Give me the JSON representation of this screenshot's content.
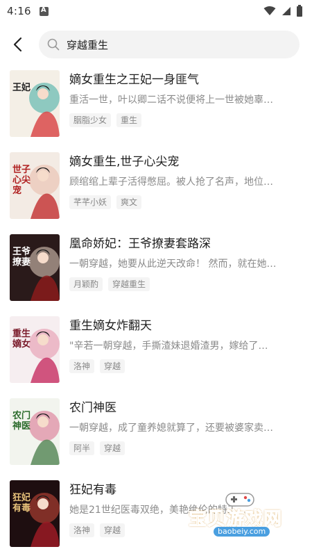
{
  "status_bar": {
    "time": "4:16"
  },
  "search": {
    "value": "穿越重生",
    "placeholder": ""
  },
  "books": [
    {
      "title": "嫡女重生之王妃一身匪气",
      "desc": "重活一世，叶以卿二话不说便将上一世被她辜…",
      "tags": [
        "胭脂少女",
        "重生"
      ],
      "cover_text": "王妃"
    },
    {
      "title": "嫡女重生,世子心尖宠",
      "desc": "顾绾绾上辈子活得憋屈。被人抢了名声，地位…",
      "tags": [
        "芊芊小妖",
        "爽文"
      ],
      "cover_text": "世子心尖宠"
    },
    {
      "title": "凰命娇妃：王爷撩妻套路深",
      "desc": "一朝穿越，她要从此逆天改命！ 然而，就在她…",
      "tags": [
        "月颖酌",
        "穿越重生"
      ],
      "cover_text": "王爷撩妻"
    },
    {
      "title": "重生嫡女炸翻天",
      "desc": "\"辛若一朝穿越，手撕渣妹退婚渣男，嫁给了…",
      "tags": [
        "洛神",
        "穿越"
      ],
      "cover_text": "重生嫡女"
    },
    {
      "title": "农门神医",
      "desc": "一朝穿越，成了童养媳就算了，还要被婆家卖…",
      "tags": [
        "阿半",
        "穿越"
      ],
      "cover_text": "农门神医"
    },
    {
      "title": "狂妃有毒",
      "desc": "她是21世纪医毒双绝，美艳绝伦的特工…",
      "tags": [
        "洛神",
        "穿越"
      ],
      "cover_text": "狂妃有毒"
    }
  ],
  "watermark": {
    "text": "宝贝游戏网",
    "url": "baobeiy.com"
  },
  "colors": {
    "accent": "#f5a623",
    "tag_bg": "#f4f4f4",
    "search_bg": "#f3f3f3"
  }
}
